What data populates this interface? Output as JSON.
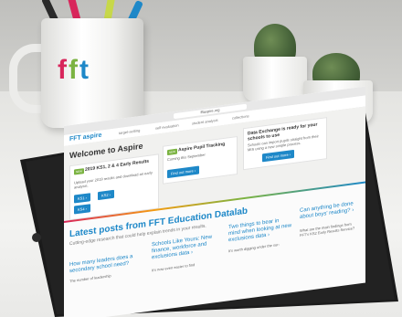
{
  "mug": {
    "logo": [
      "f",
      "f",
      "t"
    ]
  },
  "browser": {
    "url": "fftaspire.org"
  },
  "site": {
    "logo": "FFT aspire",
    "nav": [
      "target-setting",
      "self evaluation",
      "student analysis",
      "collections"
    ],
    "welcome": "Welcome to Aspire",
    "cards": [
      {
        "badge": "NEW",
        "title": "2019 KS1, 2 & 4 Early Results",
        "text": "Upload your 2019 results and download an early analysis.",
        "buttons": [
          "KS1 ›",
          "KS2 ›",
          "KS4 ›"
        ]
      },
      {
        "badge": "NEW",
        "title": "Aspire Pupil Tracking",
        "text": "Coming this September",
        "buttons": [
          "Find out more ›"
        ]
      },
      {
        "badge": "",
        "title": "Data Exchange is ready for your schools to use",
        "text": "Schools can import pupils straight from their MIS using a new simple process.",
        "buttons": [
          "Find out more ›"
        ]
      }
    ],
    "blog": {
      "title": "Latest posts from FFT Education Datalab",
      "subtitle": "Cutting-edge research that could help explain trends in your results.",
      "posts": [
        {
          "title": "How many leaders does a secondary school need?",
          "text": "The number of leadership"
        },
        {
          "title": "Schools Like Yours: New finance, workforce and exclusions data ›",
          "text": "It's now even easier to find"
        },
        {
          "title": "Two things to bear in mind when looking at new exclusions data ›",
          "text": "It's worth digging under the sur-"
        },
        {
          "title": "Can anything be done about boys' reading? ›",
          "text": "What are the main findings from FFT's KS2 Early Results Service?"
        }
      ]
    }
  },
  "colors": {
    "brand_blue": "#1e88c8",
    "brand_pink": "#d8265b",
    "brand_green": "#7bb342"
  }
}
